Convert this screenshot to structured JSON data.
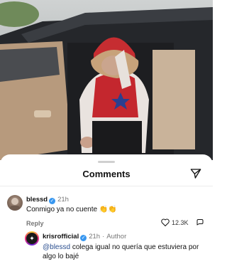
{
  "sheet": {
    "title": "Comments"
  },
  "comments": [
    {
      "username": "blessd",
      "verified": true,
      "time": "21h",
      "text": "Conmigo ya no cuente",
      "emoji": "👏👏",
      "reply_label": "Reply",
      "likes": "12.3K"
    },
    {
      "username": "krisrofficial",
      "verified": true,
      "time": "21h",
      "role": "Author",
      "mention": "@blessd",
      "text": "colega igual no quería que estuviera por algo lo bajé"
    }
  ],
  "icons": {
    "share": "send-icon",
    "like": "heart-icon",
    "reply": "reply-icon",
    "verified": "verified-badge-icon"
  },
  "colors": {
    "verified": "#3897f0",
    "mention": "#2b4f8f",
    "divider": "#ececec"
  }
}
